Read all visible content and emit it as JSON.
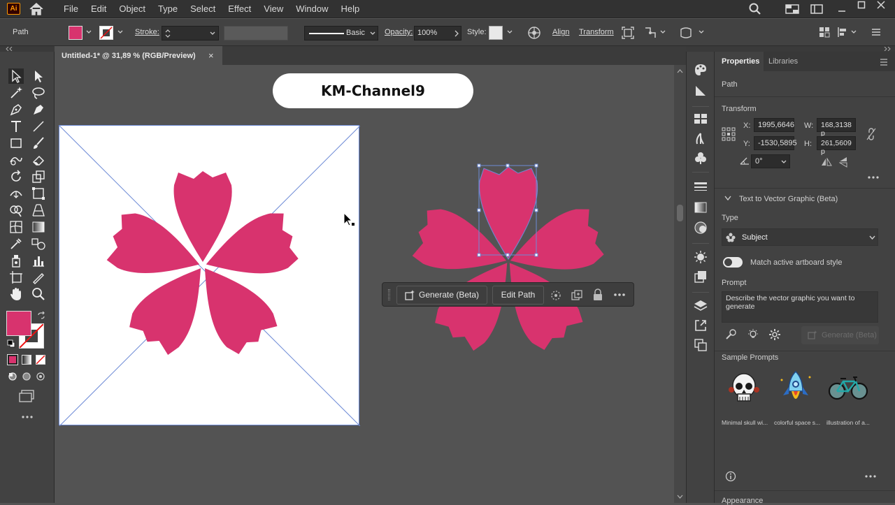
{
  "app": {
    "logo": "Ai",
    "watermark": "KM-Channel9"
  },
  "menu": [
    "File",
    "Edit",
    "Object",
    "Type",
    "Select",
    "Effect",
    "View",
    "Window",
    "Help"
  ],
  "control_bar": {
    "selection": "Path",
    "stroke_label": "Stroke:",
    "brush": "Basic",
    "opacity_label": "Opacity:",
    "opacity_value": "100%",
    "style_label": "Style:",
    "align": "Align",
    "transform": "Transform"
  },
  "document": {
    "tab_title": "Untitled-1* @ 31,89 % (RGB/Preview)",
    "close": "×"
  },
  "context_bar": {
    "generate": "Generate (Beta)",
    "edit_path": "Edit Path"
  },
  "colors": {
    "fill": "#d8336e",
    "flower": "#d8336e",
    "selection": "#6e8bd6"
  },
  "properties": {
    "tabs": [
      "Properties",
      "Libraries"
    ],
    "object_type": "Path",
    "transform_title": "Transform",
    "x_label": "X:",
    "x_value": "1995,6646",
    "y_label": "Y:",
    "y_value": "-1530,5895",
    "w_label": "W:",
    "w_value": "168,3138 p",
    "h_label": "H:",
    "h_value": "261,5609 p",
    "angle_value": "0°",
    "t2v_title": "Text to Vector Graphic (Beta)",
    "type_label": "Type",
    "type_value": "Subject",
    "match_style": "Match active artboard style",
    "prompt_label": "Prompt",
    "prompt_placeholder": "Describe the vector graphic you want to generate",
    "generate_button": "Generate (Beta)",
    "sample_title": "Sample Prompts",
    "samples": [
      "Minimal skull wi...",
      "colorful space s...",
      "illustration of a..."
    ],
    "appearance": "Appearance"
  }
}
